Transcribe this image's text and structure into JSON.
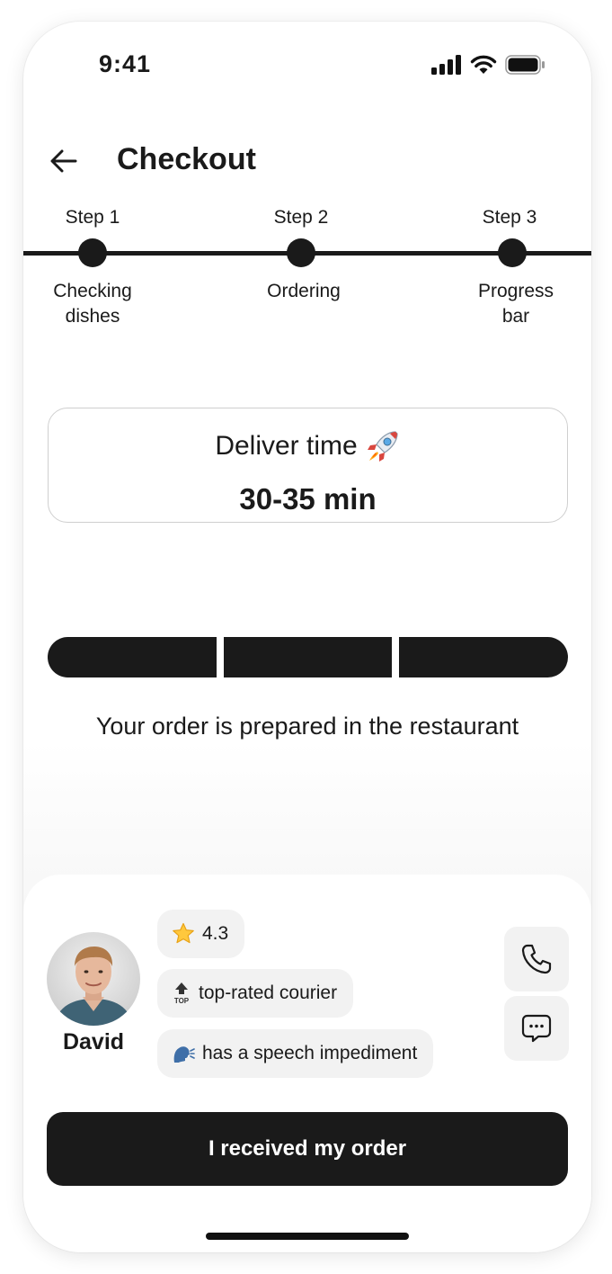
{
  "status_bar": {
    "time": "9:41",
    "icons": [
      "cellular-signal-icon",
      "wifi-icon",
      "battery-icon"
    ]
  },
  "header": {
    "back_icon": "arrow-left-icon",
    "title": "Checkout"
  },
  "stepper": {
    "steps": [
      {
        "label": "Step 1",
        "caption_line1": "Checking",
        "caption_line2": "dishes"
      },
      {
        "label": "Step 2",
        "caption_line1": "Ordering",
        "caption_line2": ""
      },
      {
        "label": "Step 3",
        "caption_line1": "Progress",
        "caption_line2": "bar"
      }
    ]
  },
  "delivery": {
    "title": "Deliver time",
    "title_icon": "rocket-icon",
    "value": "30-35 min"
  },
  "progress": {
    "segments_total": 3,
    "segments_filled": 3,
    "status_text": "Your order is prepared in the restaurant"
  },
  "courier": {
    "name": "David",
    "rating": "4.3",
    "rating_icon": "star-icon",
    "badges": [
      {
        "icon": "top-arrow-icon",
        "text": "top-rated courier"
      },
      {
        "icon": "speaking-head-icon",
        "text": "has a speech impediment"
      }
    ],
    "actions": [
      "phone-icon",
      "chat-icon"
    ]
  },
  "cta": {
    "label": "I received my order"
  },
  "colors": {
    "primary": "#1a1a1a",
    "chip_background": "#f2f2f2",
    "card_border": "#cfcfcf",
    "background": "#ffffff"
  }
}
